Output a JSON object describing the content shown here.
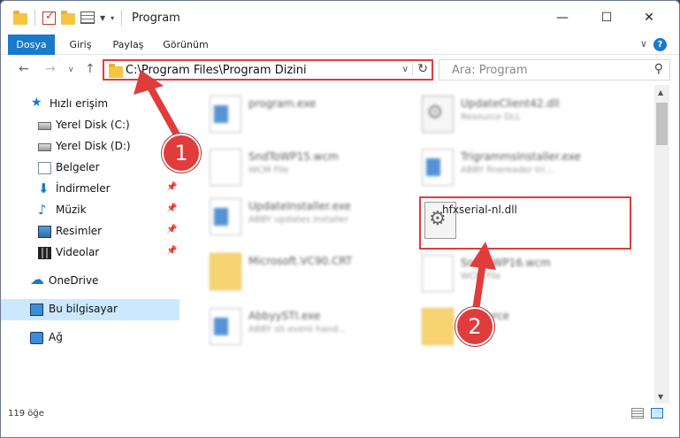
{
  "window": {
    "title": "Program"
  },
  "ribbon": {
    "tabs": [
      "Dosya",
      "Giriş",
      "Paylaş",
      "Görünüm"
    ]
  },
  "address": {
    "path": "C:\\Program Files\\Program Dizini"
  },
  "search": {
    "placeholder": "Ara: Program"
  },
  "sidebar": {
    "items": [
      {
        "label": "Hızlı erişim",
        "icon": "star-icon"
      },
      {
        "label": "Yerel Disk (C:)",
        "icon": "disk-icon"
      },
      {
        "label": "Yerel Disk (D:)",
        "icon": "disk-icon"
      },
      {
        "label": "Belgeler",
        "icon": "documents-icon"
      },
      {
        "label": "İndirmeler",
        "icon": "download-icon"
      },
      {
        "label": "Müzik",
        "icon": "music-icon"
      },
      {
        "label": "Resimler",
        "icon": "pictures-icon"
      },
      {
        "label": "Videolar",
        "icon": "video-icon"
      },
      {
        "label": "OneDrive",
        "icon": "cloud-icon"
      },
      {
        "label": "Bu bilgisayar",
        "icon": "pc-icon"
      },
      {
        "label": "Ağ",
        "icon": "network-icon"
      }
    ]
  },
  "files": [
    {
      "name": "program.exe",
      "sub": ""
    },
    {
      "name": "UpdateClient42.dll",
      "sub": "Resource DLL"
    },
    {
      "name": "SndToWP15.wcm",
      "sub": "WCM File"
    },
    {
      "name": "TrigrammsInstaller.exe",
      "sub": "ABBY finereader tri..."
    },
    {
      "name": "UpdateInstaller.exe",
      "sub": "ABBY updates installer"
    },
    {
      "name": "hfxserial-nl.dll",
      "sub": ""
    },
    {
      "name": "Microsoft.VC90.CRT",
      "sub": ""
    },
    {
      "name": "SndToWP16.wcm",
      "sub": "WCM File"
    },
    {
      "name": "AbbyySTI.exe",
      "sub": "ABBY sti event hand..."
    },
    {
      "name": "Resource",
      "sub": ""
    }
  ],
  "status": {
    "count": "119 öğe"
  },
  "callouts": [
    "1",
    "2"
  ],
  "colors": {
    "accent": "#1979ca",
    "highlight": "#e03c3c"
  }
}
